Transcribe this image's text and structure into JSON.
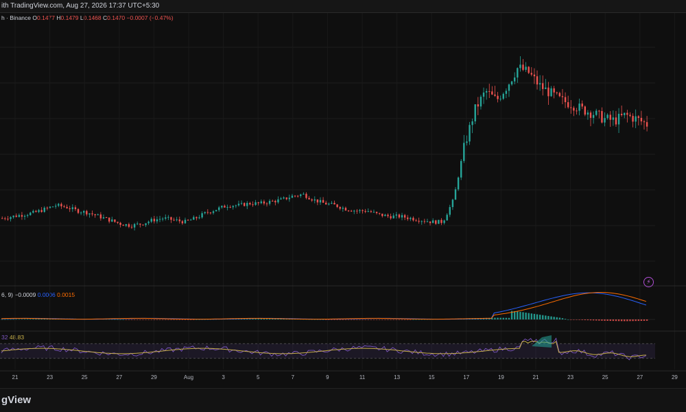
{
  "header": {
    "snapshot_text": "ith TradingView.com, Aug 27, 2026 17:37 UTC+5:30"
  },
  "legend": {
    "exchange": "h · Binance",
    "o_label": "O",
    "o_value": "0.1477",
    "h_label": "H",
    "h_value": "0.1479",
    "l_label": "L",
    "l_value": "0.1468",
    "c_label": "C",
    "c_value": "0.1470",
    "change": "−0.0007 (−0.47%)"
  },
  "macd_legend": {
    "params": "6, 9)",
    "histogram": "−0.0009",
    "macd": "0.0006",
    "signal": "0.0015"
  },
  "rsi_legend": {
    "params": "32",
    "value": "48.83"
  },
  "footer": {
    "brand": "gView"
  },
  "colors": {
    "up": "#26a69a",
    "down": "#ef5350",
    "macd_line": "#2962ff",
    "signal_line": "#ff6d00",
    "rsi_line": "#7e57c2",
    "rsi_ma": "#c9b04a"
  },
  "chart_data": {
    "type": "candlestick",
    "interval": "hourly",
    "x_ticks": [
      "21",
      "23",
      "25",
      "27",
      "29",
      "Aug",
      "3",
      "5",
      "7",
      "9",
      "11",
      "13",
      "15",
      "17",
      "19",
      "21",
      "23",
      "25",
      "27",
      "29"
    ],
    "price_series": [
      0.096,
      0.097,
      0.098,
      0.099,
      0.101,
      0.103,
      0.102,
      0.1,
      0.099,
      0.097,
      0.095,
      0.093,
      0.092,
      0.093,
      0.095,
      0.096,
      0.095,
      0.094,
      0.096,
      0.099,
      0.101,
      0.103,
      0.103,
      0.104,
      0.104,
      0.105,
      0.106,
      0.108,
      0.109,
      0.106,
      0.104,
      0.103,
      0.101,
      0.1,
      0.1,
      0.098,
      0.097,
      0.097,
      0.096,
      0.095,
      0.094,
      0.094,
      0.106,
      0.135,
      0.155,
      0.165,
      0.16,
      0.168,
      0.178,
      0.175,
      0.168,
      0.164,
      0.16,
      0.158,
      0.155,
      0.153,
      0.15,
      0.149,
      0.152,
      0.15,
      0.147
    ],
    "y_range": [
      0.06,
      0.2
    ],
    "macd_histogram": [
      0.0001,
      0.0003,
      0.0005,
      0.0006,
      0.0004,
      0.0002,
      -0.0001,
      -0.0003,
      -0.0002,
      0.0,
      0.0002,
      0.0004,
      0.0006,
      0.0005,
      0.0002,
      0.0,
      -0.0002,
      -0.0003,
      -0.0002,
      0.0,
      0.0002,
      0.0005,
      0.0009,
      0.0012,
      0.001,
      0.0006,
      0.0002,
      -0.0004,
      -0.0009,
      -0.0012,
      -0.0009
    ],
    "rsi_levels": [
      70,
      30
    ],
    "last_rsi": 48.83,
    "last_macd": 0.0006,
    "last_signal": 0.0015
  }
}
